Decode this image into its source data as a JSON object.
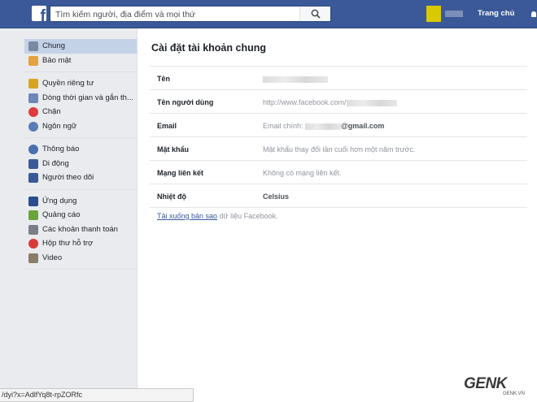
{
  "topbar": {
    "search_placeholder": "Tìm kiếm người, địa điểm và mọi thứ",
    "home_label": "Trang chủ",
    "brand_color": "#3b5998"
  },
  "sidebar": {
    "groups": [
      [
        {
          "label": "Chung",
          "icon": "gear-icon",
          "active": true
        },
        {
          "label": "Bảo mật",
          "icon": "shield-icon"
        }
      ],
      [
        {
          "label": "Quyền riêng tư",
          "icon": "lock-icon"
        },
        {
          "label": "Dòng thời gian và gắn th...",
          "icon": "timeline-icon"
        },
        {
          "label": "Chặn",
          "icon": "block-icon"
        },
        {
          "label": "Ngôn ngữ",
          "icon": "globe-icon"
        }
      ],
      [
        {
          "label": "Thông báo",
          "icon": "notification-globe-icon"
        },
        {
          "label": "Di động",
          "icon": "mobile-icon"
        },
        {
          "label": "Người theo dõi",
          "icon": "rss-icon"
        }
      ],
      [
        {
          "label": "Ứng dụng",
          "icon": "apps-icon"
        },
        {
          "label": "Quảng cáo",
          "icon": "ads-icon"
        },
        {
          "label": "Các khoản thanh toán",
          "icon": "credit-card-icon"
        },
        {
          "label": "Hộp thư hỗ trợ",
          "icon": "support-lifebuoy-icon"
        },
        {
          "label": "Video",
          "icon": "video-film-icon"
        }
      ]
    ]
  },
  "main": {
    "title": "Cài đặt tài khoản chung",
    "rows": [
      {
        "label": "Tên",
        "prefix": "",
        "suffix": ""
      },
      {
        "label": "Tên người dùng",
        "prefix": "http://www.facebook.com/",
        "suffix": ""
      },
      {
        "label": "Email",
        "prefix": "Email chính: ",
        "suffix": "@gmail.com"
      },
      {
        "label": "Mật khẩu",
        "prefix": "Mật khẩu thay đổi lần cuối hơn một năm trước.",
        "suffix": ""
      },
      {
        "label": "Mạng liên kết",
        "prefix": "Không có mạng liên kết.",
        "suffix": ""
      },
      {
        "label": "Nhiệt độ",
        "prefix": "Celsius",
        "suffix": ""
      }
    ],
    "download_link": "Tải xuống bản sao",
    "download_rest": " dữ liệu Facebook."
  },
  "statusbar": {
    "url": "/dyi?x=AdlfYq8t-rpZORfc"
  },
  "watermark": {
    "main": "GENK",
    "sub": "GENK.VN"
  }
}
